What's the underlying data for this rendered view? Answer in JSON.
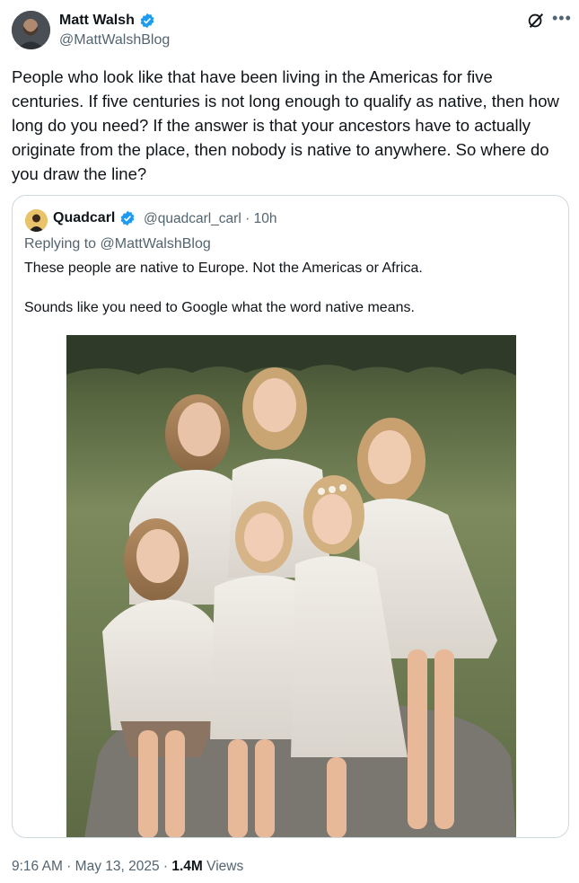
{
  "author": {
    "name": "Matt Walsh",
    "handle": "@MattWalshBlog",
    "verified": true,
    "avatar_icon": "profile-photo"
  },
  "tweet": {
    "text": "People who look like that have been living in the Americas for five centuries. If five centuries is not long enough to qualify as native, then how long do you need? If the answer is that your ancestors have to actually originate from the place, then nobody is native to anywhere. So where do you draw the line?"
  },
  "quoted": {
    "name": "Quadcarl",
    "verified": true,
    "handle": "@quadcarl_carl",
    "separator": "·",
    "time": "10h",
    "replying_prefix": "Replying to ",
    "replying_to": "@MattWalshBlog",
    "text1": "These people are native to Europe. Not the Americas or Africa.",
    "text2": "Sounds like you need to Google what the word native means.",
    "image_icon": "group-photo"
  },
  "meta": {
    "time": "9:16 AM",
    "sep1": " · ",
    "date": "May 13, 2025",
    "sep2": " · ",
    "views_count": "1.4M",
    "views_label": " Views"
  },
  "colors": {
    "text": "#0f1419",
    "secondary": "#536471",
    "verified": "#1d9bf0",
    "border": "#cfd9de"
  },
  "icons": {
    "verified": "verified-badge-icon",
    "grok": "grok-icon",
    "more": "more-icon"
  }
}
